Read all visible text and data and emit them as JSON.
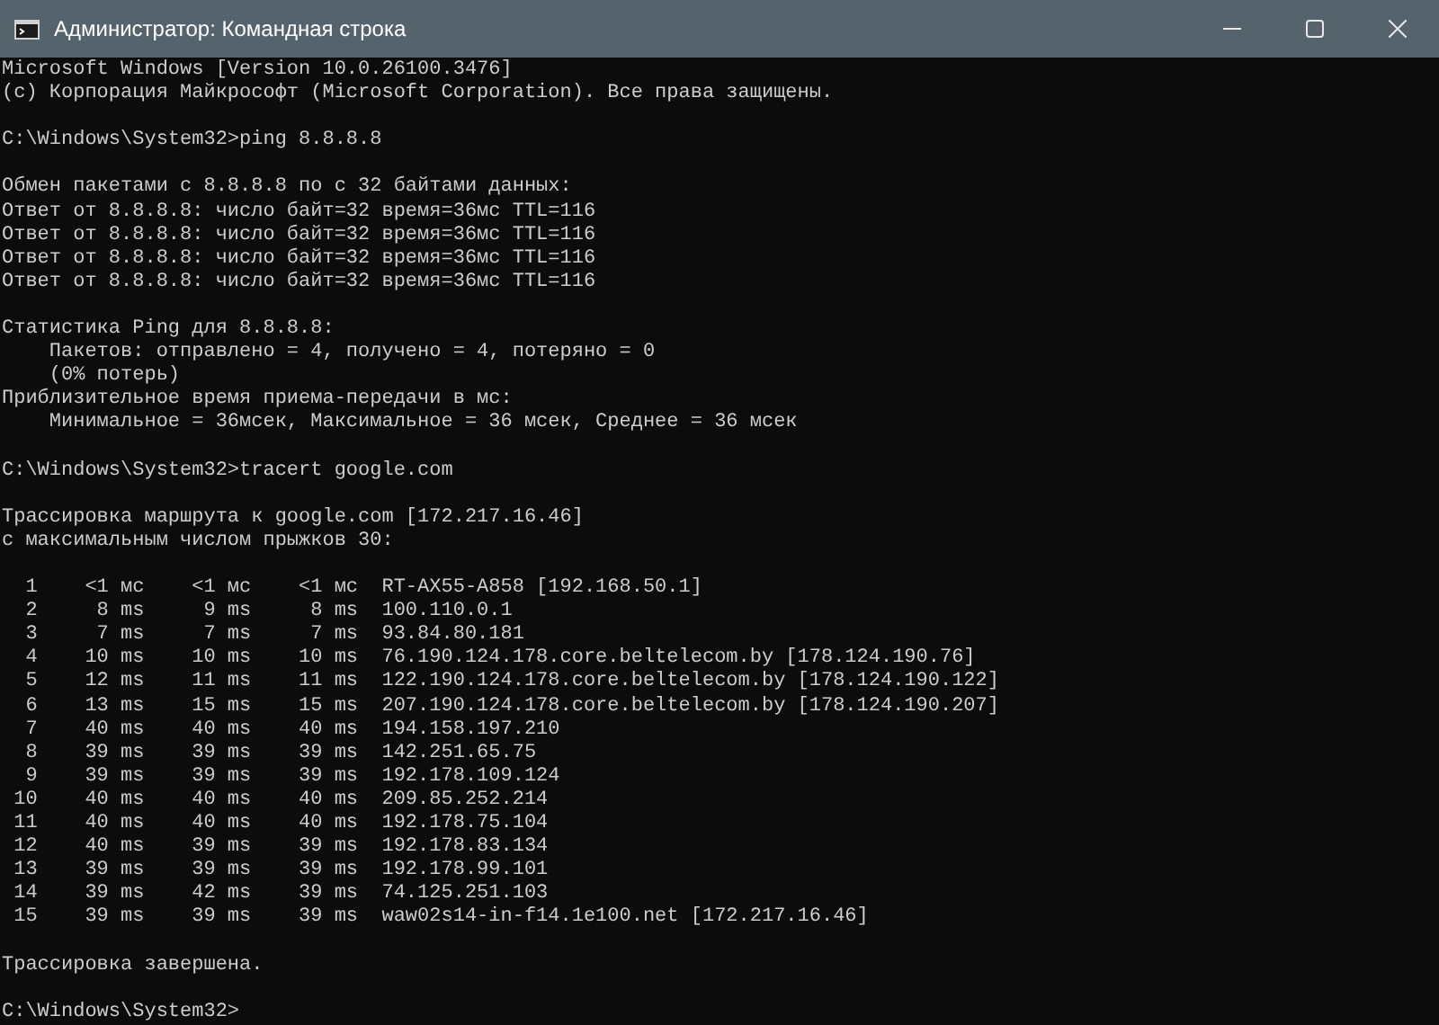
{
  "window": {
    "title": "Администратор: Командная строка"
  },
  "console": {
    "blocks": [
      {
        "lines": [
          "Microsoft Windows [Version 10.0.26100.3476]",
          "(c) Корпорация Майкрософт (Microsoft Corporation). Все права защищены."
        ]
      },
      {
        "lines": [
          "C:\\Windows\\System32>ping 8.8.8.8"
        ]
      },
      {
        "lines": [
          "Обмен пакетами с 8.8.8.8 по с 32 байтами данных:",
          "Ответ от 8.8.8.8: число байт=32 время=36мс TTL=116",
          "Ответ от 8.8.8.8: число байт=32 время=36мс TTL=116",
          "Ответ от 8.8.8.8: число байт=32 время=36мс TTL=116",
          "Ответ от 8.8.8.8: число байт=32 время=36мс TTL=116"
        ]
      },
      {
        "lines": [
          "Статистика Ping для 8.8.8.8:",
          "    Пакетов: отправлено = 4, получено = 4, потеряно = 0",
          "    (0% потерь)",
          "Приблизительное время приема-передачи в мс:",
          "    Минимальное = 36мсек, Максимальное = 36 мсек, Среднее = 36 мсек"
        ]
      },
      {
        "lines": [
          "C:\\Windows\\System32>tracert google.com"
        ]
      },
      {
        "lines": [
          "Трассировка маршрута к google.com [172.217.16.46]",
          "с максимальным числом прыжков 30:"
        ]
      },
      {
        "lines": [
          "  1    <1 мс    <1 мс    <1 мс  RT-AX55-A858 [192.168.50.1]",
          "  2     8 ms     9 ms     8 ms  100.110.0.1",
          "  3     7 ms     7 ms     7 ms  93.84.80.181",
          "  4    10 ms    10 ms    10 ms  76.190.124.178.core.beltelecom.by [178.124.190.76]",
          "  5    12 ms    11 ms    11 ms  122.190.124.178.core.beltelecom.by [178.124.190.122]",
          "  6    13 ms    15 ms    15 ms  207.190.124.178.core.beltelecom.by [178.124.190.207]",
          "  7    40 ms    40 ms    40 ms  194.158.197.210",
          "  8    39 ms    39 ms    39 ms  142.251.65.75",
          "  9    39 ms    39 ms    39 ms  192.178.109.124",
          " 10    40 ms    40 ms    40 ms  209.85.252.214",
          " 11    40 ms    40 ms    40 ms  192.178.75.104",
          " 12    40 ms    39 ms    39 ms  192.178.83.134",
          " 13    39 ms    39 ms    39 ms  192.178.99.101",
          " 14    39 ms    42 ms    39 ms  74.125.251.103",
          " 15    39 ms    39 ms    39 ms  waw02s14-in-f14.1e100.net [172.217.16.46]"
        ]
      },
      {
        "lines": [
          "Трассировка завершена."
        ]
      },
      {
        "lines": [
          "C:\\Windows\\System32>"
        ]
      }
    ]
  }
}
